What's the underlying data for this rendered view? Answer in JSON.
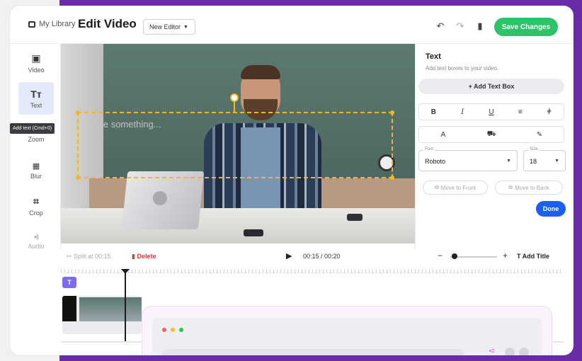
{
  "header": {
    "breadcrumb_root": "My Library",
    "breadcrumb_sep": "›",
    "title": "Edit Video",
    "editor_select": "New Editor",
    "save_label": "Save Changes"
  },
  "toolbar": {
    "items": [
      {
        "label": "Video",
        "icon": "film-icon",
        "glyph": "▣"
      },
      {
        "label": "Text",
        "icon": "text-icon",
        "glyph": "Tт"
      },
      {
        "label": "Zoom",
        "icon": "zoom-icon",
        "glyph": "⊕"
      },
      {
        "label": "Blur",
        "icon": "blur-icon",
        "glyph": "▦"
      },
      {
        "label": "Crop",
        "icon": "crop-icon",
        "glyph": "⌗"
      },
      {
        "label": "Audio",
        "icon": "audio-icon",
        "glyph": "◂)"
      }
    ],
    "tooltip": "Add text (Cmd+0)"
  },
  "video": {
    "textbox_placeholder": "Write something..."
  },
  "panel": {
    "title": "Text",
    "subtitle": "Add text boxes to your video.",
    "add_text_label": "+ Add Text Box",
    "format_row1": [
      "B",
      "I",
      "U",
      "≡",
      "⫩"
    ],
    "format_row2": [
      "A",
      "⛟",
      "✎"
    ],
    "font_label": "Font",
    "font_value": "Roboto",
    "size_label": "Size",
    "size_value": "18",
    "move_front_label": "Move to Front",
    "move_back_label": "Move to Back",
    "done_label": "Done"
  },
  "timeline": {
    "split_label": "Split at 00:15",
    "delete_label": "Delete",
    "time_display": "00:15 / 00:20",
    "add_title_label": "Add Title",
    "text_chip": "T"
  },
  "colors": {
    "accent_green": "#2ec26a",
    "accent_blue": "#1a5ff0",
    "delete_red": "#e0333a",
    "selection_yellow": "#f1b81b",
    "chip_purple": "#7c6cf5",
    "background_purple": "#6a2ba8"
  }
}
